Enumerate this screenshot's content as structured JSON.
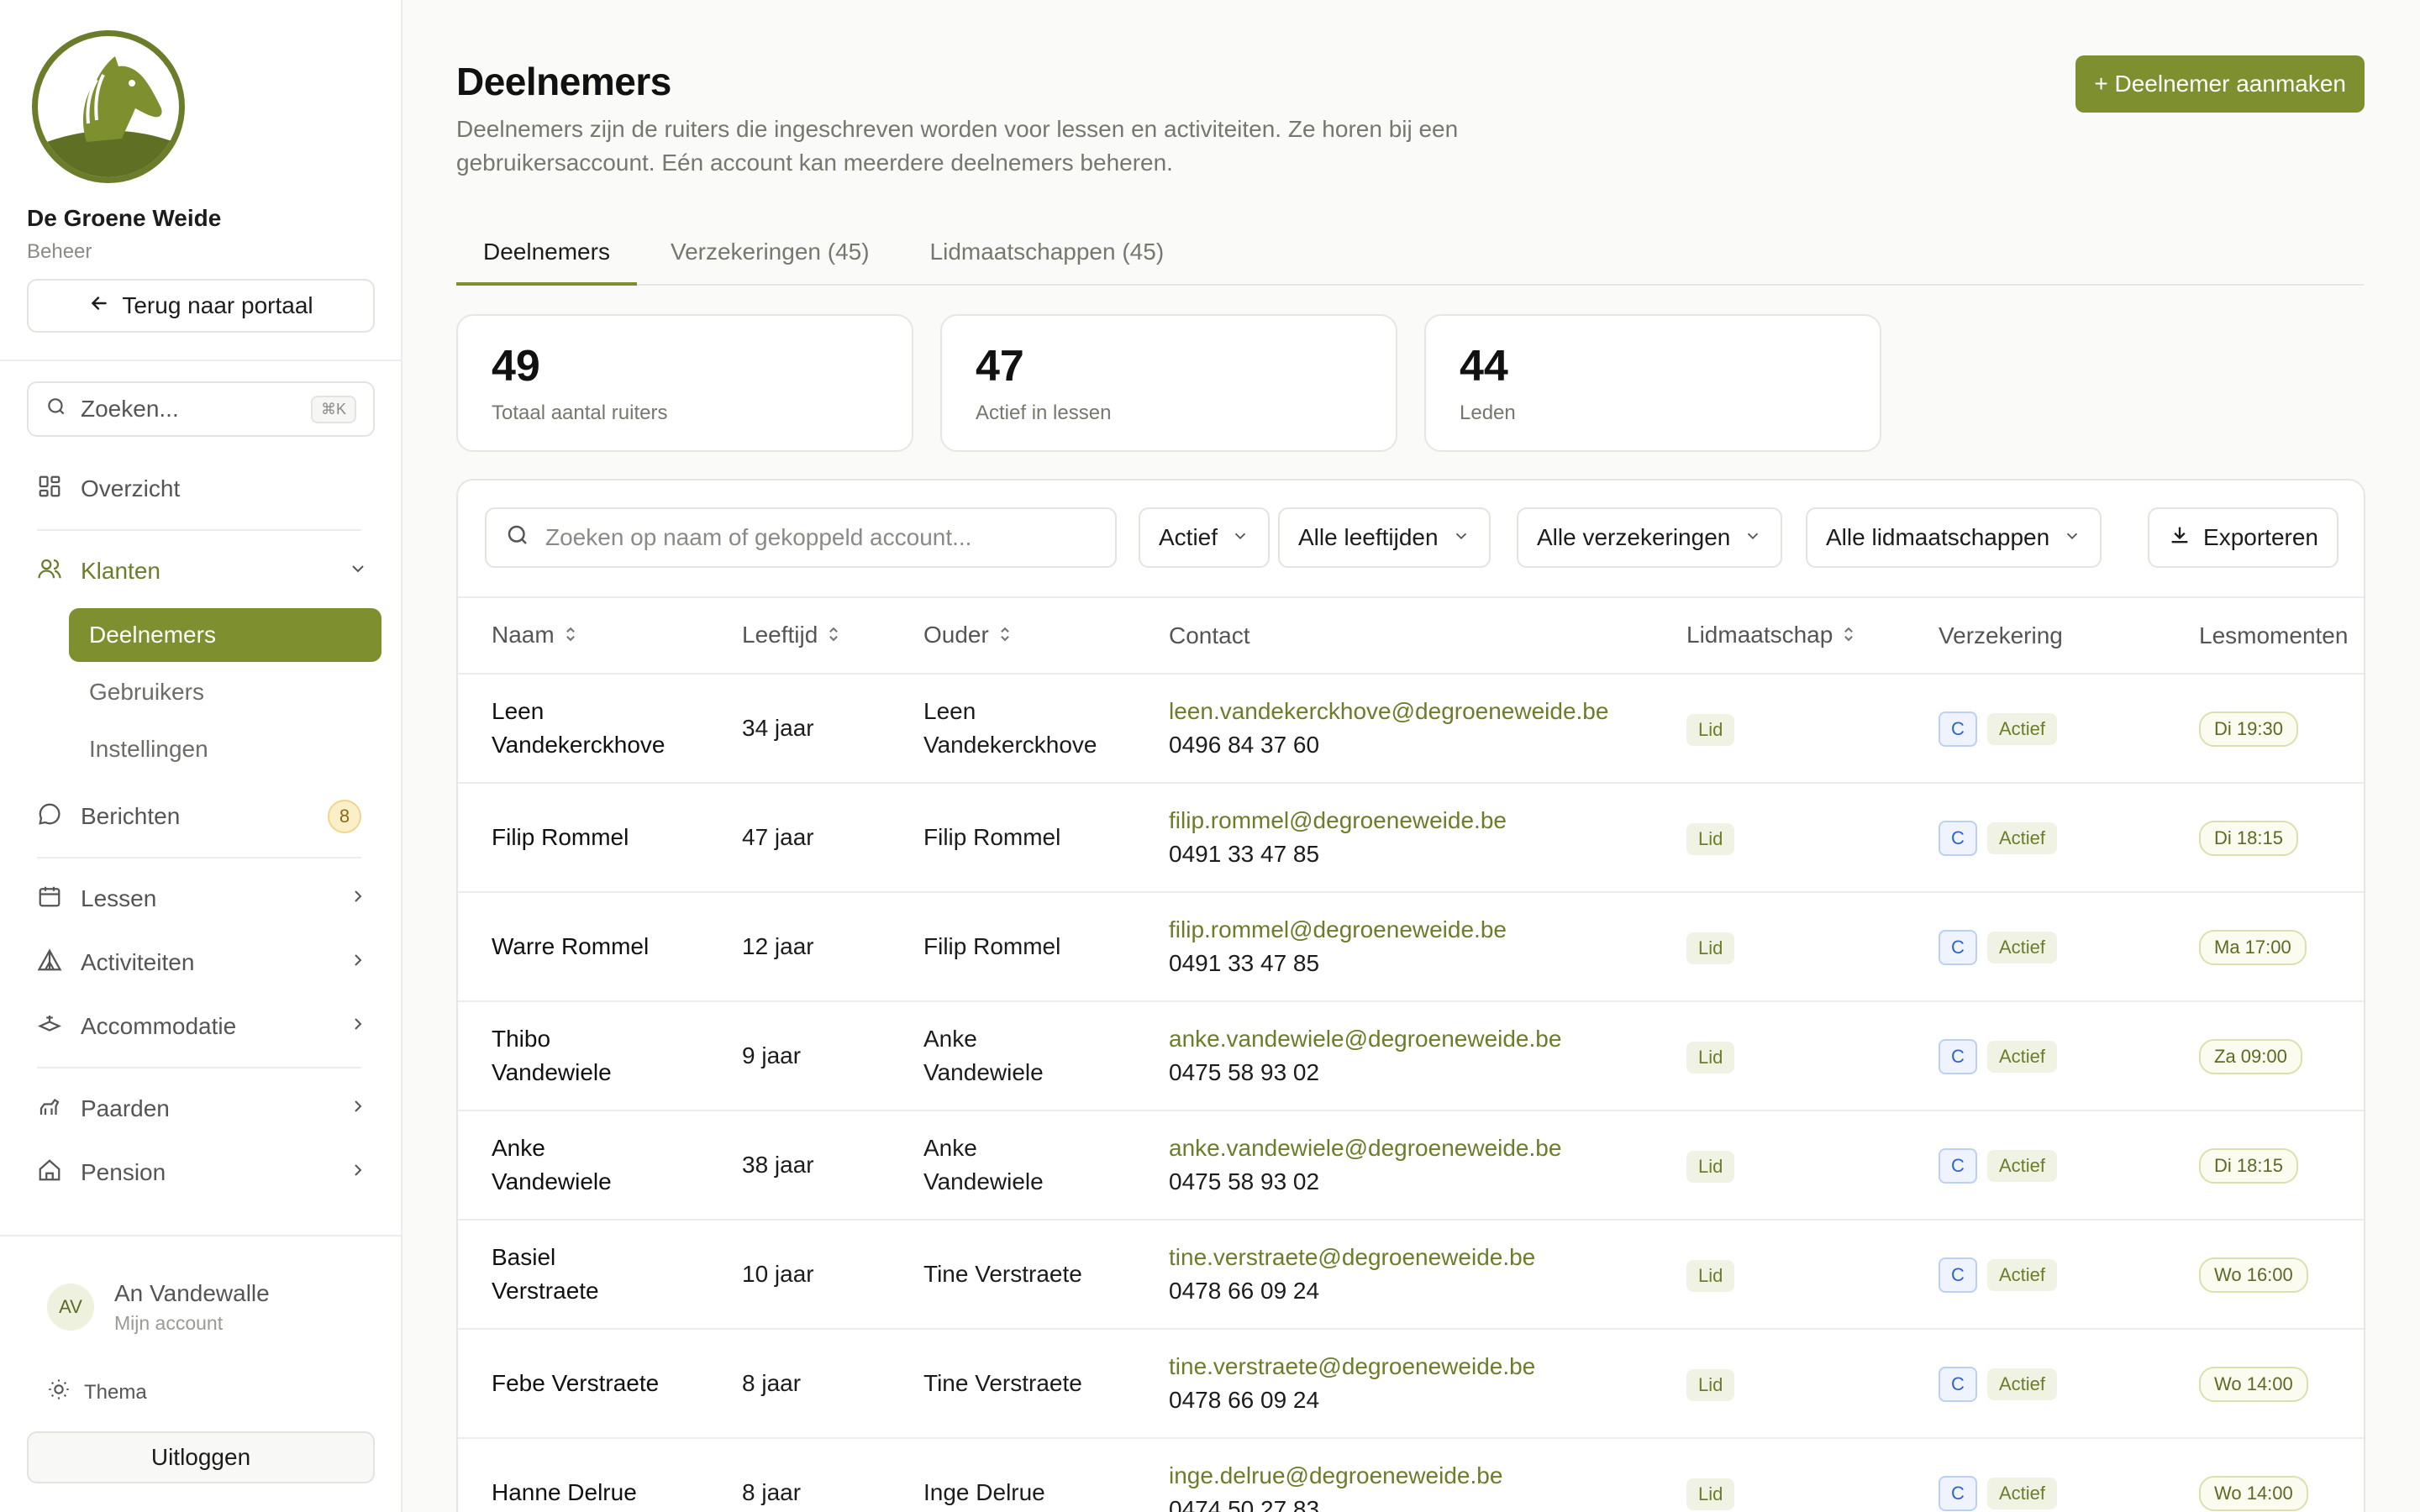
{
  "sidebar": {
    "org_name": "De Groene Weide",
    "org_sub": "Beheer",
    "back_label": "Terug naar portaal",
    "search_placeholder": "Zoeken...",
    "search_shortcut": "⌘K",
    "nav": {
      "overzicht": "Overzicht",
      "klanten": "Klanten",
      "deelnemers": "Deelnemers",
      "gebruikers": "Gebruikers",
      "instellingen": "Instellingen",
      "berichten": "Berichten",
      "berichten_count": "8",
      "lessen": "Lessen",
      "activiteiten": "Activiteiten",
      "accommodatie": "Accommodatie",
      "paarden": "Paarden",
      "pension": "Pension"
    },
    "user": {
      "initials": "AV",
      "name": "An Vandewalle",
      "sub": "Mijn account"
    },
    "theme_label": "Thema",
    "logout_label": "Uitloggen"
  },
  "header": {
    "title": "Deelnemers",
    "description": "Deelnemers zijn de ruiters die ingeschreven worden voor lessen en activiteiten. Ze horen bij een gebruikersaccount. Eén account kan meerdere deelnemers beheren.",
    "create_label": "+ Deelnemer aanmaken"
  },
  "tabs": [
    {
      "label": "Deelnemers"
    },
    {
      "label": "Verzekeringen (45)"
    },
    {
      "label": "Lidmaatschappen (45)"
    }
  ],
  "stats": [
    {
      "value": "49",
      "label": "Totaal aantal ruiters"
    },
    {
      "value": "47",
      "label": "Actief in lessen"
    },
    {
      "value": "44",
      "label": "Leden"
    }
  ],
  "filters": {
    "search_placeholder": "Zoeken op naam of gekoppeld account...",
    "status": "Actief",
    "age": "Alle leeftijden",
    "insurance": "Alle verzekeringen",
    "membership": "Alle lidmaatschappen",
    "export_label": "Exporteren"
  },
  "table": {
    "columns": {
      "naam": "Naam",
      "leeftijd": "Leeftijd",
      "ouder": "Ouder",
      "contact": "Contact",
      "lidmaatschap": "Lidmaatschap",
      "verzekering": "Verzekering",
      "lesmomenten": "Lesmomenten"
    },
    "rows": [
      {
        "name_1": "Leen",
        "name_2": "Vandekerckhove",
        "age": "34 jaar",
        "parent_1": "Leen",
        "parent_2": "Vandekerckhove",
        "email": "leen.vandekerckhove@degroeneweide.be",
        "phone": "0496 84 37 60",
        "membership": "Lid",
        "ins_type": "C",
        "ins_status": "Actief",
        "lesson": "Di 19:30"
      },
      {
        "name_1": "Filip Rommel",
        "name_2": "",
        "age": "47 jaar",
        "parent_1": "Filip Rommel",
        "parent_2": "",
        "email": "filip.rommel@degroeneweide.be",
        "phone": "0491 33 47 85",
        "membership": "Lid",
        "ins_type": "C",
        "ins_status": "Actief",
        "lesson": "Di 18:15"
      },
      {
        "name_1": "Warre Rommel",
        "name_2": "",
        "age": "12 jaar",
        "parent_1": "Filip Rommel",
        "parent_2": "",
        "email": "filip.rommel@degroeneweide.be",
        "phone": "0491 33 47 85",
        "membership": "Lid",
        "ins_type": "C",
        "ins_status": "Actief",
        "lesson": "Ma 17:00"
      },
      {
        "name_1": "Thibo",
        "name_2": "Vandewiele",
        "age": "9 jaar",
        "parent_1": "Anke",
        "parent_2": "Vandewiele",
        "email": "anke.vandewiele@degroeneweide.be",
        "phone": "0475 58 93 02",
        "membership": "Lid",
        "ins_type": "C",
        "ins_status": "Actief",
        "lesson": "Za 09:00"
      },
      {
        "name_1": "Anke",
        "name_2": "Vandewiele",
        "age": "38 jaar",
        "parent_1": "Anke",
        "parent_2": "Vandewiele",
        "email": "anke.vandewiele@degroeneweide.be",
        "phone": "0475 58 93 02",
        "membership": "Lid",
        "ins_type": "C",
        "ins_status": "Actief",
        "lesson": "Di 18:15"
      },
      {
        "name_1": "Basiel",
        "name_2": "Verstraete",
        "age": "10 jaar",
        "parent_1": "Tine Verstraete",
        "parent_2": "",
        "email": "tine.verstraete@degroeneweide.be",
        "phone": "0478 66 09 24",
        "membership": "Lid",
        "ins_type": "C",
        "ins_status": "Actief",
        "lesson": "Wo 16:00"
      },
      {
        "name_1": "Febe Verstraete",
        "name_2": "",
        "age": "8 jaar",
        "parent_1": "Tine Verstraete",
        "parent_2": "",
        "email": "tine.verstraete@degroeneweide.be",
        "phone": "0478 66 09 24",
        "membership": "Lid",
        "ins_type": "C",
        "ins_status": "Actief",
        "lesson": "Wo 14:00"
      },
      {
        "name_1": "Hanne Delrue",
        "name_2": "",
        "age": "8 jaar",
        "parent_1": "Inge Delrue",
        "parent_2": "",
        "email": "inge.delrue@degroeneweide.be",
        "phone": "0474 50 27 83",
        "membership": "Lid",
        "ins_type": "C",
        "ins_status": "Actief",
        "lesson": "Wo 14:00"
      }
    ]
  },
  "colors": {
    "accent": "#7d8f2f",
    "accent_text": "#6b7d2a",
    "insurance_blue": "#2f63c8"
  }
}
